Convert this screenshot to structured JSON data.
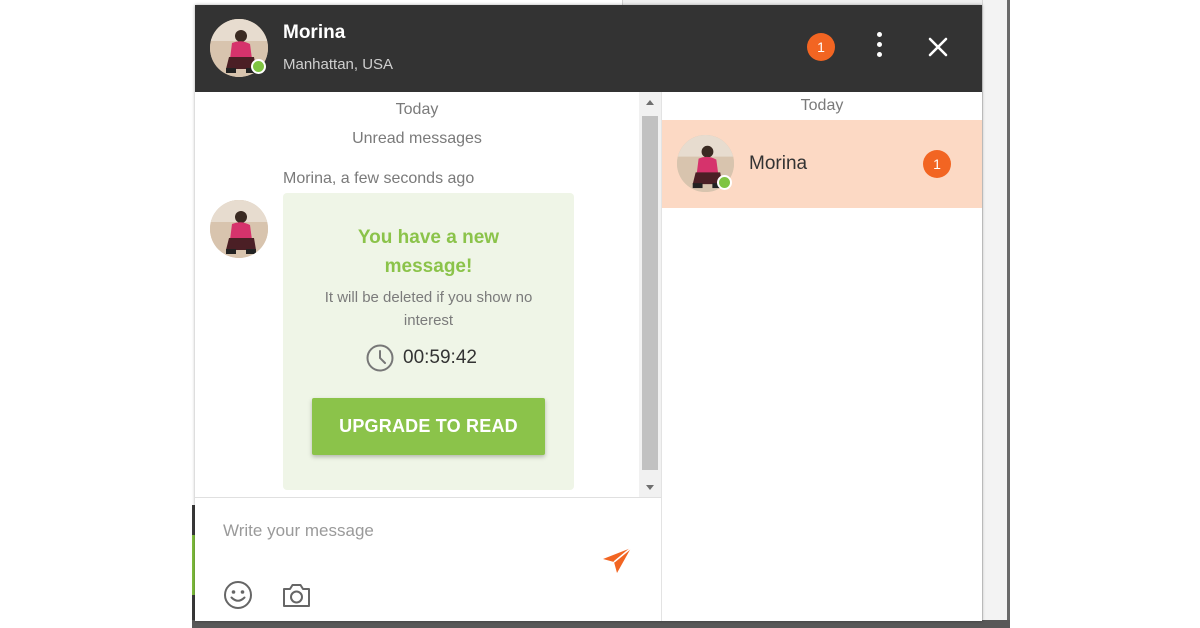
{
  "header": {
    "name": "Morina",
    "location": "Manhattan, USA",
    "notification_count": "1",
    "avatar_icon": "user-photo",
    "status_color": "#7fc442"
  },
  "chat": {
    "date_label": "Today",
    "unread_label": "Unread messages",
    "message_meta": "Morina, a few seconds ago",
    "card": {
      "title": "You have a new message!",
      "subtitle": "It will be deleted if you show no interest",
      "timer": "00:59:42",
      "button_label": "UPGRADE TO READ"
    }
  },
  "composer": {
    "placeholder": "Write your message",
    "value": ""
  },
  "conversations": {
    "date_label": "Today",
    "items": [
      {
        "name": "Morina",
        "unread": "1"
      }
    ]
  },
  "colors": {
    "header_bg": "#333333",
    "accent_orange": "#f26522",
    "accent_green": "#8bc34a",
    "card_bg": "#eff5e7",
    "selected_conversation_bg": "#fcd9c4"
  }
}
